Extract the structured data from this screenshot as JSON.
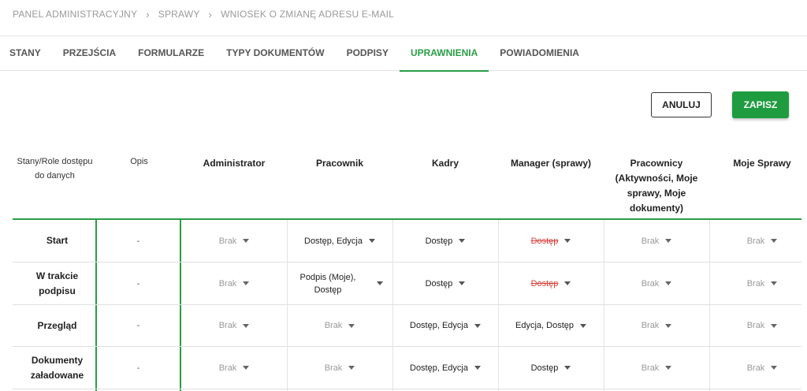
{
  "breadcrumb": [
    "PANEL ADMINISTRACYJNY",
    "SPRAWY",
    "WNIOSEK O ZMIANĘ ADRESU E-MAIL"
  ],
  "tabs": [
    {
      "label": "STANY"
    },
    {
      "label": "PRZEJŚCIA"
    },
    {
      "label": "FORMULARZE"
    },
    {
      "label": "TYPY DOKUMENTÓW"
    },
    {
      "label": "PODPISY"
    },
    {
      "label": "UPRAWNIENIA",
      "active": true
    },
    {
      "label": "POWIADOMIENIA"
    }
  ],
  "actions": {
    "cancel_label": "ANULUJ",
    "save_label": "ZAPISZ"
  },
  "colors": {
    "accent": "#2a9d46",
    "save_bg": "#1e9c3f",
    "strike": "#d9413c",
    "muted": "#9a9a9a"
  },
  "table": {
    "corner_header": "Stany/Role dostępu do danych",
    "desc_header": "Opis",
    "role_headers": [
      "Administrator",
      "Pracownik",
      "Kadry",
      "Manager (sprawy)",
      "Pracownicy (Aktywności, Moje sprawy, Moje dokumenty)",
      "Moje Sprawy"
    ],
    "rows": [
      {
        "state": "Start",
        "desc": "-",
        "cells": [
          {
            "value": "Brak",
            "style": "off"
          },
          {
            "value": "Dostęp, Edycja",
            "style": "on"
          },
          {
            "value": "Dostęp",
            "style": "on"
          },
          {
            "value": "Dostęp",
            "style": "strike"
          },
          {
            "value": "Brak",
            "style": "off"
          },
          {
            "value": "Brak",
            "style": "off"
          }
        ]
      },
      {
        "state": "W trakcie podpisu",
        "desc": "-",
        "cells": [
          {
            "value": "Brak",
            "style": "off"
          },
          {
            "value": "Podpis (Moje), Dostęp",
            "style": "on"
          },
          {
            "value": "Dostęp",
            "style": "on"
          },
          {
            "value": "Dostęp",
            "style": "strike"
          },
          {
            "value": "Brak",
            "style": "off"
          },
          {
            "value": "Brak",
            "style": "off"
          }
        ]
      },
      {
        "state": "Przegląd",
        "desc": "-",
        "cells": [
          {
            "value": "Brak",
            "style": "off"
          },
          {
            "value": "Brak",
            "style": "off"
          },
          {
            "value": "Dostęp, Edycja",
            "style": "on"
          },
          {
            "value": "Edycja, Dostęp",
            "style": "on"
          },
          {
            "value": "Brak",
            "style": "off"
          },
          {
            "value": "Brak",
            "style": "off"
          }
        ]
      },
      {
        "state": "Dokumenty załadowane",
        "desc": "-",
        "cells": [
          {
            "value": "Brak",
            "style": "off"
          },
          {
            "value": "Brak",
            "style": "off"
          },
          {
            "value": "Dostęp, Edycja",
            "style": "on"
          },
          {
            "value": "Dostęp",
            "style": "on"
          },
          {
            "value": "Brak",
            "style": "off"
          },
          {
            "value": "Brak",
            "style": "off"
          }
        ]
      }
    ]
  }
}
